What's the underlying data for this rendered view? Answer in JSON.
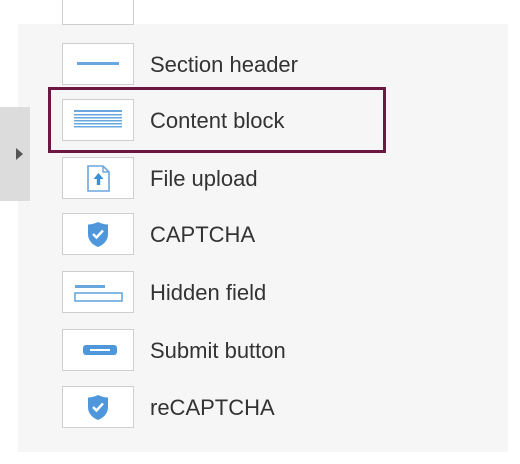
{
  "palette": {
    "icon_blue": "#6aa7df",
    "selection_outline": "#6b1740",
    "label_text": "#333333"
  },
  "items": [
    {
      "label": "Section header",
      "icon": "section-header-icon",
      "selected": false
    },
    {
      "label": "Content block",
      "icon": "content-block-icon",
      "selected": true
    },
    {
      "label": "File upload",
      "icon": "file-upload-icon",
      "selected": false
    },
    {
      "label": "CAPTCHA",
      "icon": "shield-check-icon",
      "selected": false
    },
    {
      "label": "Hidden field",
      "icon": "hidden-field-icon",
      "selected": false
    },
    {
      "label": "Submit button",
      "icon": "submit-button-icon",
      "selected": false
    },
    {
      "label": "reCAPTCHA",
      "icon": "shield-check-icon",
      "selected": false
    }
  ]
}
